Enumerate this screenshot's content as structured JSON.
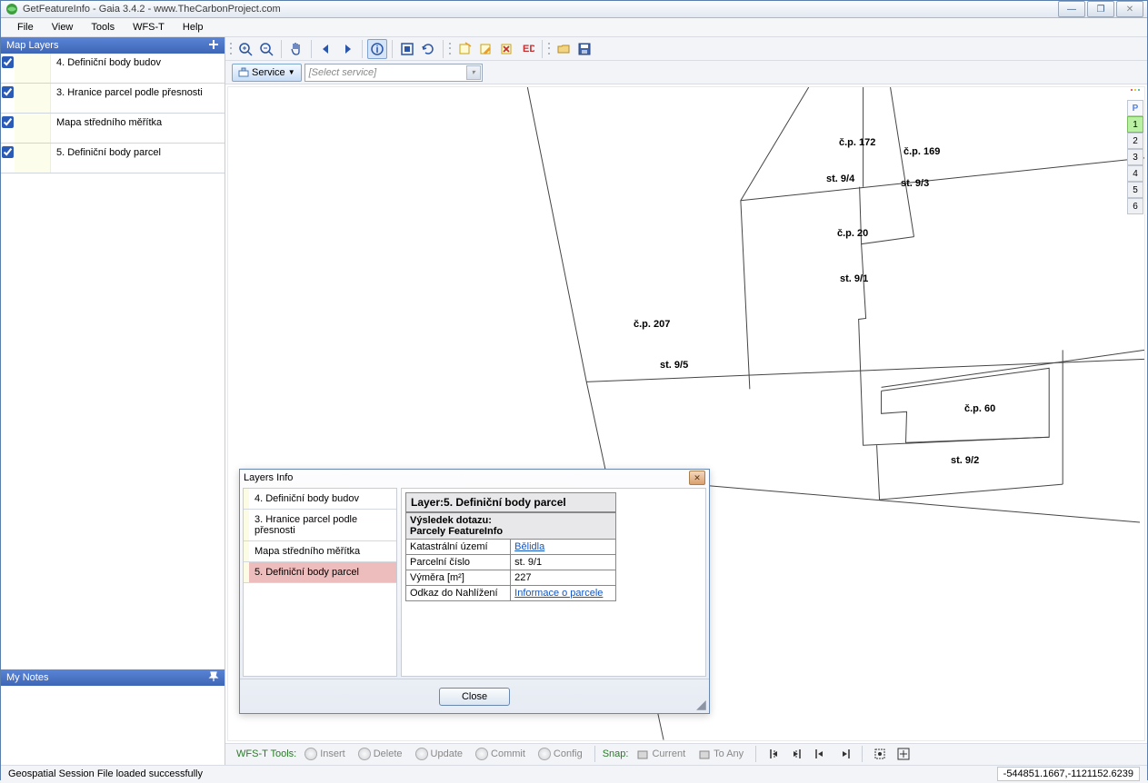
{
  "window": {
    "title": "GetFeatureInfo - Gaia 3.4.2 - www.TheCarbonProject.com",
    "min": "—",
    "max": "▭",
    "close": "✕"
  },
  "menu": [
    "File",
    "View",
    "Tools",
    "WFS-T",
    "Help"
  ],
  "panels": {
    "map_layers": "Map Layers",
    "my_notes": "My Notes"
  },
  "layers": [
    {
      "checked": true,
      "name": "4. Definiční body budov"
    },
    {
      "checked": true,
      "name": "3. Hranice parcel podle přesnosti"
    },
    {
      "checked": true,
      "name": "Mapa středního měřítka"
    },
    {
      "checked": true,
      "name": "5. Definiční body parcel"
    }
  ],
  "service_bar": {
    "btn": "Service",
    "placeholder": "[Select service]"
  },
  "right_nav": {
    "header": "P",
    "items": [
      "1",
      "2",
      "3",
      "4",
      "5",
      "6"
    ],
    "selected": 0
  },
  "map_labels": {
    "cp172": "č.p. 172",
    "cp169": "č.p. 169",
    "st94": "st. 9/4",
    "st93": "st. 9/3",
    "cp20": "č.p. 20",
    "st91": "st. 9/1",
    "cp207": "č.p. 207",
    "st95": "st. 9/5",
    "cp60": "č.p. 60",
    "st92": "st. 9/2"
  },
  "dialog": {
    "title": "Layers Info",
    "layers": [
      "4. Definiční body budov",
      "3. Hranice parcel podle přesnosti",
      "Mapa středního měřítka",
      "5. Definiční body parcel"
    ],
    "selected": 3,
    "result": {
      "header": "Layer:5. Definiční body parcel",
      "subhead1": "Výsledek dotazu:",
      "subhead2": "Parcely FeatureInfo",
      "rows": [
        {
          "k": "Katastrální území",
          "v": "Bělidla",
          "link": true
        },
        {
          "k": "Parcelní číslo",
          "v": "st. 9/1",
          "link": false
        },
        {
          "k": "Výměra [m²]",
          "v": "227",
          "link": false
        },
        {
          "k": "Odkaz do Nahlížení",
          "v": "Informace o parcele",
          "link": true
        }
      ]
    },
    "close": "Close"
  },
  "bottom": {
    "lead": "WFS-T Tools:",
    "btns": [
      "Insert",
      "Delete",
      "Update",
      "Commit",
      "Config"
    ],
    "snap": "Snap:",
    "snapbtns": [
      "Current",
      "To Any"
    ]
  },
  "status": {
    "msg": "Geospatial Session File loaded successfully",
    "coord": "-544851.1667,-1121152.6239"
  }
}
